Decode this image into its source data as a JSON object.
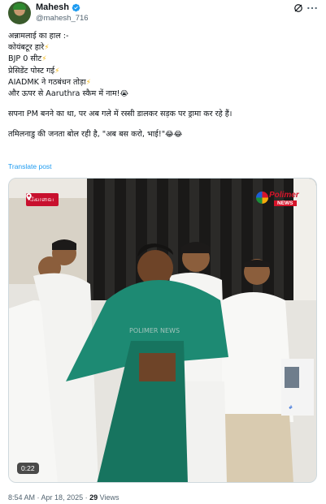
{
  "author": {
    "name": "Mahesh",
    "handle": "@mahesh_716",
    "verified": true,
    "avatar_icon": "avatar-image"
  },
  "header_icons": [
    "grok-icon",
    "more-icon"
  ],
  "tweet_lines": [
    "अन्नामलाई का हाल :-",
    "कोयंबटूर हारे",
    "BJP 0 सीट",
    "प्रेसिडेंट पोस्ट गई",
    "AIADMK ने गठबंधन तोड़ा",
    "और ऊपर से Aaruthra स्कैम में नाम!",
    "सपना PM बनने का था, पर अब गले में रस्सी डालकर सड़क पर ड्रामा कर रहे हैं।",
    "तमिलनाडु की जनता बोल रही है, \"अब बस करो, भाई!\""
  ],
  "emojis": {
    "bolt": "⚡",
    "sad": "😭",
    "laugh": "😂"
  },
  "translate_label": "Translate post",
  "media": {
    "location_label": "கோவை",
    "channel_name": "Polimer",
    "channel_sub": "NEWS",
    "watermark": "POLIMER NEWS",
    "duration": "0:22"
  },
  "meta": {
    "time": "8:54 AM",
    "date": "Apr 18, 2025",
    "views_count": "29",
    "views_label": "Views",
    "separator": " · "
  },
  "colors": {
    "link": "#1d9bf0",
    "muted": "#536471",
    "verified": "#1d9bf0",
    "badge": "#c8102e"
  }
}
